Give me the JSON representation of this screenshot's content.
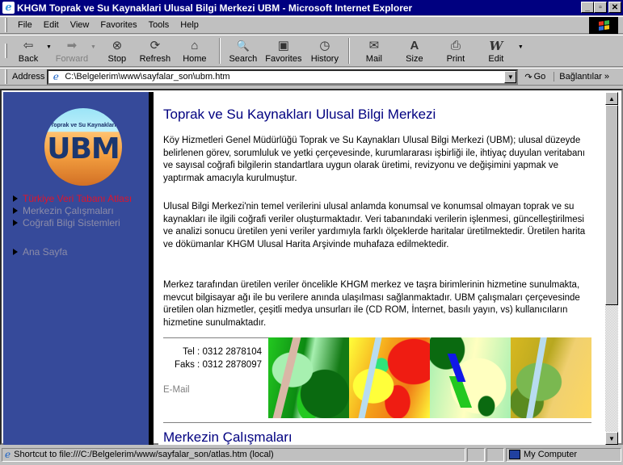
{
  "window": {
    "title": "KHGM Toprak ve Su Kaynaklari Ulusal Bilgi Merkezi UBM - Microsoft Internet Explorer",
    "minimize": "_",
    "maximize": "▫",
    "close": "✕"
  },
  "menu": {
    "items": [
      {
        "label": "File"
      },
      {
        "label": "Edit"
      },
      {
        "label": "View"
      },
      {
        "label": "Favorites"
      },
      {
        "label": "Tools"
      },
      {
        "label": "Help"
      }
    ]
  },
  "toolbar": {
    "back": {
      "label": "Back",
      "icon": "⇦"
    },
    "forward": {
      "label": "Forward",
      "icon": "➡"
    },
    "stop": {
      "label": "Stop",
      "icon": "⊗"
    },
    "refresh": {
      "label": "Refresh",
      "icon": "⟳"
    },
    "home": {
      "label": "Home",
      "icon": "⌂"
    },
    "search": {
      "label": "Search",
      "icon": "🔍"
    },
    "favorites": {
      "label": "Favorites",
      "icon": "▣"
    },
    "history": {
      "label": "History",
      "icon": "◷"
    },
    "mail": {
      "label": "Mail",
      "icon": "✉"
    },
    "size": {
      "label": "Size",
      "icon": "A"
    },
    "print": {
      "label": "Print",
      "icon": "⎙"
    },
    "edit": {
      "label": "Edit",
      "icon": "W"
    },
    "dropdown": "▼"
  },
  "address": {
    "label": "Address",
    "value": "C:\\Belgelerim\\www\\sayfalar_son\\ubm.htm",
    "go_label": "Go",
    "links_label": "Bağlantılar »"
  },
  "sidebar": {
    "logo": {
      "top_text": "Toprak ve Su Kaynakları",
      "big_text": "UBM"
    },
    "items": [
      {
        "label": "Türkiye Veri Tabanı Atlası",
        "active": true
      },
      {
        "label": "Merkezin Çalışmaları",
        "active": false
      },
      {
        "label": "Coğrafi Bilgi Sistemleri",
        "active": false
      },
      {
        "label": "Ana Sayfa",
        "active": false
      }
    ],
    "colors": {
      "background": "#364a9a",
      "active": "#e0142b",
      "inactive": "#8c8ca8"
    }
  },
  "content": {
    "heading": "Toprak ve Su Kaynakları Ulusal Bilgi Merkezi",
    "paragraphs": [
      "Köy Hizmetleri Genel Müdürlüğü Toprak ve Su Kaynakları Ulusal Bilgi Merkezi (UBM); ulusal düzeyde belirlenen görev, sorumluluk ve yetki çerçevesinde, kurumlararası işbirliği ile, ihtiyaç duyulan veritabanı ve sayısal coğrafi bilgilerin standartlara uygun olarak üretimi, revizyonu ve değişimini yapmak ve yaptırmak amacıyla kurulmuştur.",
      "Ulusal Bilgi Merkezi'nin temel verilerini ulusal anlamda konumsal ve konumsal olmayan toprak ve su kaynakları ile ilgili coğrafi veriler oluşturmaktadır. Veri tabanındaki verilerin işlenmesi, güncelleştirilmesi ve analizi sonucu üretilen yeni veriler yardımıyla farklı ölçeklerde haritalar üretilmektedir. Üretilen harita ve dökümanlar KHGM Ulusal Harita Arşivinde muhafaza edilmektedir.",
      "Merkez tarafından üretilen veriler öncelikle KHGM merkez ve taşra birimlerinin hizmetine sunulmakta, mevcut bilgisayar ağı ile bu verilere anında ulaşılması sağlanmaktadır. UBM çalışmaları çerçevesinde üretilen olan hizmetler, çeşitli medya unsurları ile (CD ROM, İnternet, basılı yayın, vs) kullanıcıların hizmetine sunulmaktadır."
    ],
    "contact": {
      "tel": "Tel : 0312 2878104",
      "fax": "Faks : 0312 2878097",
      "email": "E-Mail"
    },
    "section2_heading": "Merkezin Çalışmaları",
    "heading_color": "#000080"
  },
  "status": {
    "text": "Shortcut to file:///C:/Belgelerim/www/sayfalar_son/atlas.htm (local)",
    "zone": "My Computer"
  }
}
